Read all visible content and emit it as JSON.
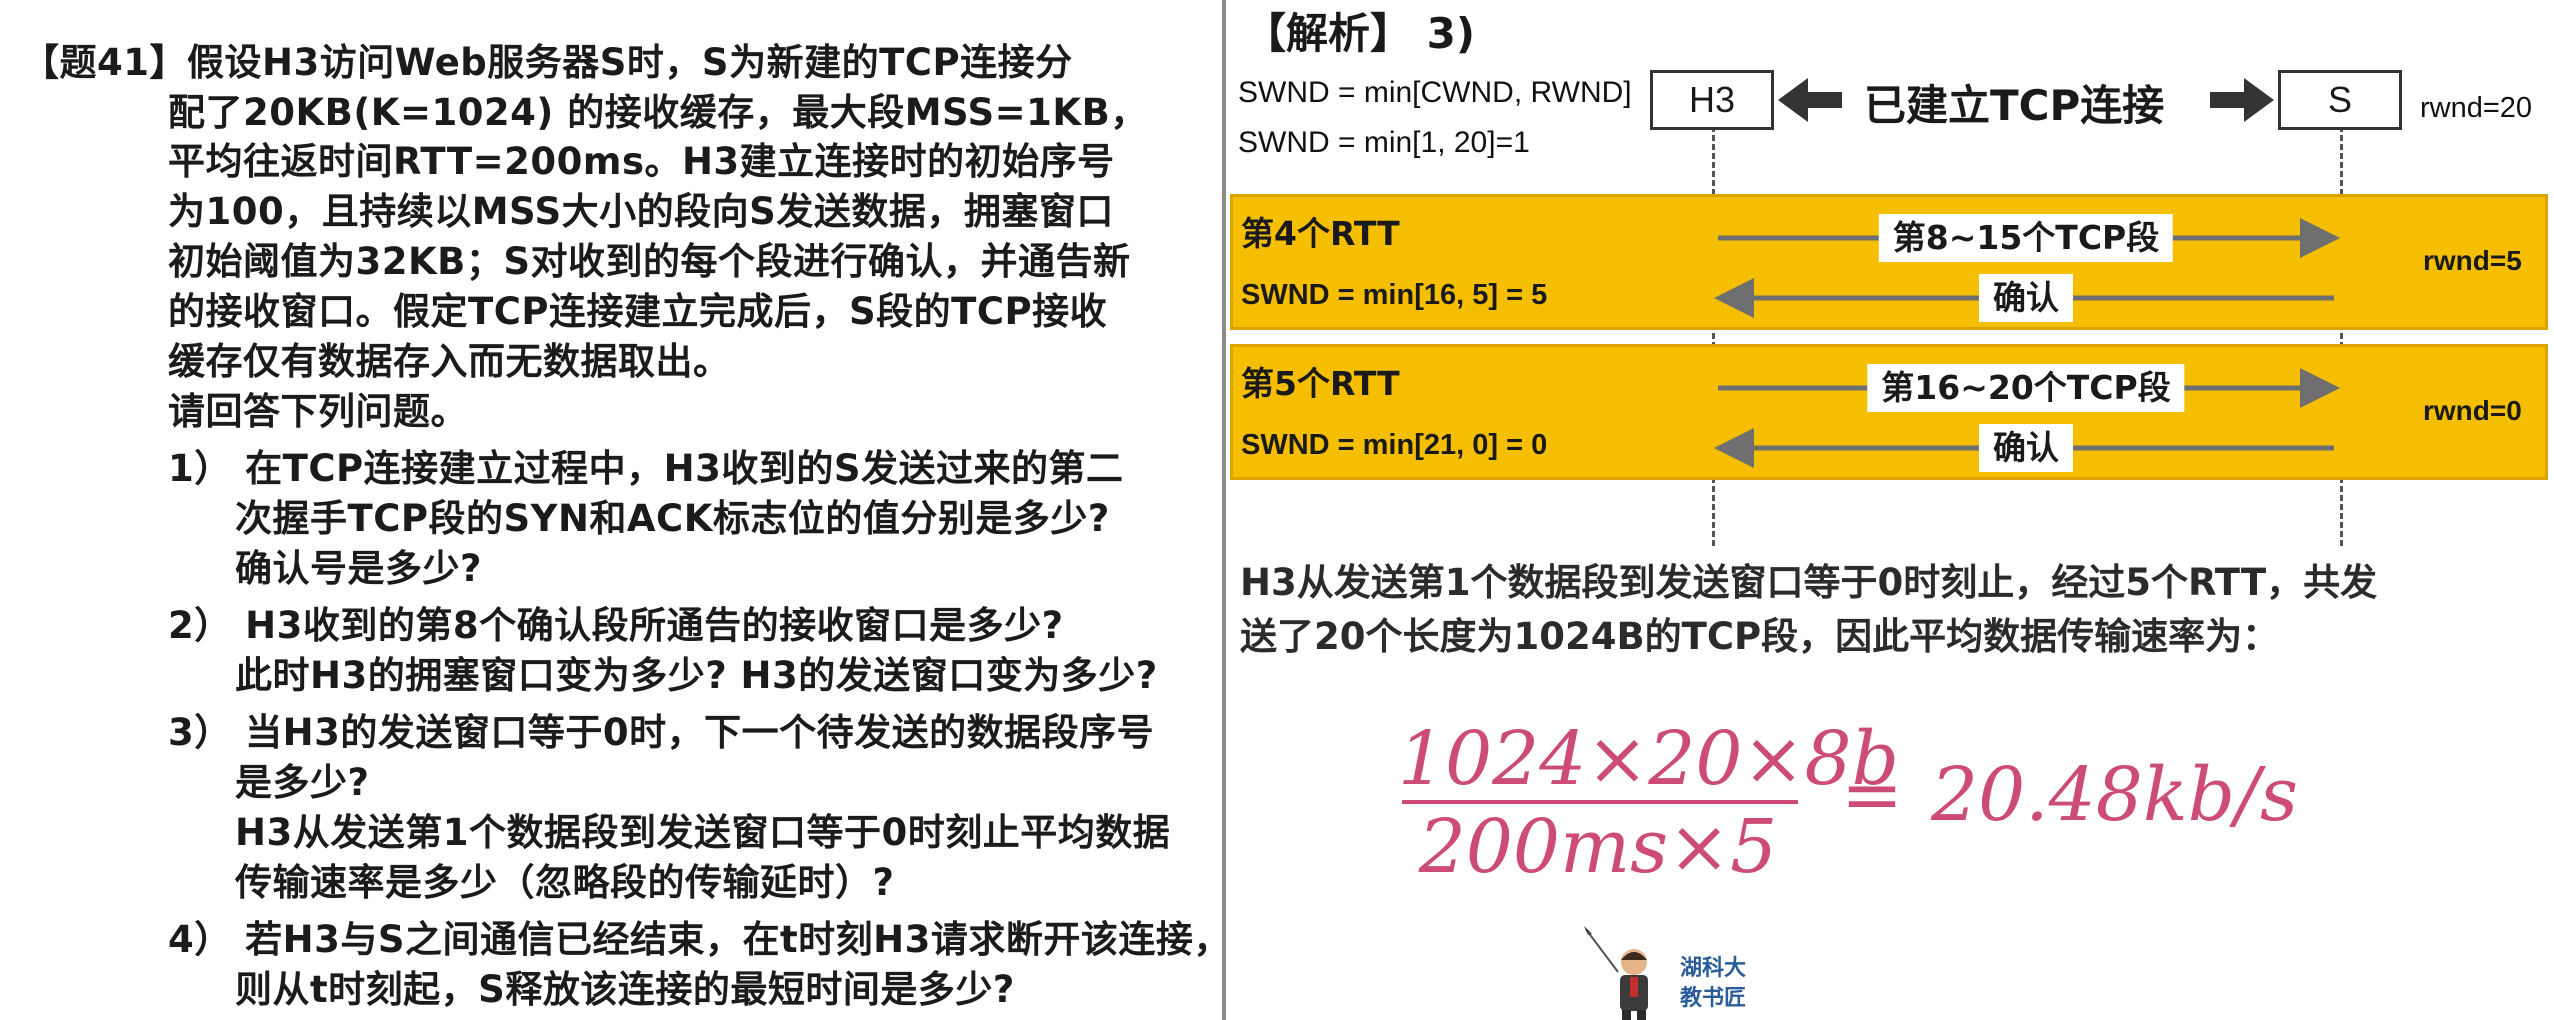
{
  "question": {
    "lines": [
      "【题41】假设H3访问Web服务器S时，S为新建的TCP连接分",
      "配了20KB(K=1024) 的接收缓存，最大段MSS=1KB，",
      "平均往返时间RTT=200ms。H3建立连接时的初始序号",
      "为100，且持续以MSS大小的段向S发送数据，拥塞窗口",
      "初始阈值为32KB；S对收到的每个段进行确认，并通告新",
      "的接收窗口。假定TCP连接建立完成后，S段的TCP接收",
      "缓存仅有数据存入而无数据取出。",
      "请回答下列问题。",
      "1）  在TCP连接建立过程中，H3收到的S发送过来的第二",
      "次握手TCP段的SYN和ACK标志位的值分别是多少?",
      "确认号是多少?",
      "2）  H3收到的第8个确认段所通告的接收窗口是多少?",
      "此时H3的拥塞窗口变为多少? H3的发送窗口变为多少?",
      "3）  当H3的发送窗口等于0时，下一个待发送的数据段序号",
      "是多少?",
      "H3从发送第1个数据段到发送窗口等于0时刻止平均数据",
      "传输速率是多少（忽略段的传输延时）?",
      "4）  若H3与S之间通信已经结束，在t时刻H3请求断开该连接，",
      "则从t时刻起，S释放该连接的最短时间是多少?"
    ]
  },
  "analysis": {
    "header": "【解析】  3)",
    "swnd_formula": "SWND = min[CWND, RWND]",
    "swnd_initial": "SWND = min[1, 20]=1",
    "left_host": "H3",
    "right_host": "S",
    "connection_label": "已建立TCP连接",
    "rwnd_initial": "rwnd=20",
    "rounds": [
      {
        "label": "第4个RTT",
        "swnd": "SWND = min[16, 5] = 5",
        "send": "第8~15个TCP段",
        "ack": "确认",
        "rwnd": "rwnd=5"
      },
      {
        "label": "第5个RTT",
        "swnd": "SWND = min[21, 0] = 0",
        "send": "第16~20个TCP段",
        "ack": "确认",
        "rwnd": "rwnd=0"
      }
    ],
    "explanation": [
      "H3从发送第1个数据段到发送窗口等于0时刻止，经过5个RTT，共发",
      "送了20个长度为1024B的TCP段，因此平均数据传输速率为："
    ],
    "formula": {
      "numerator": "1024×20×8b",
      "denominator": "200ms×5",
      "equals": "=",
      "result": "20.48kb/s"
    }
  },
  "watermark": {
    "line1": "湖科大",
    "line2": "教书匠"
  },
  "colors": {
    "band": "#f5bf00",
    "arrow": "#6e6e6e",
    "formula": "#cc4b77",
    "divider": "#8a8a8a"
  }
}
